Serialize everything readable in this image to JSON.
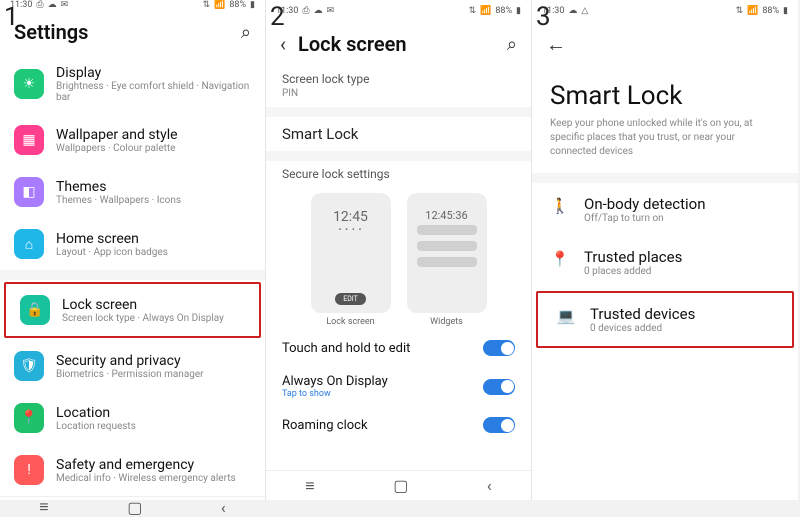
{
  "status": {
    "time": "11:30",
    "battery": "88%"
  },
  "panel1": {
    "title": "Settings",
    "items": [
      {
        "title": "Display",
        "sub": "Brightness · Eye comfort shield · Navigation bar",
        "color": "#1ec97a",
        "glyph": "☀"
      },
      {
        "title": "Wallpaper and style",
        "sub": "Wallpapers · Colour palette",
        "color": "#ff3e8e",
        "glyph": "▦"
      },
      {
        "title": "Themes",
        "sub": "Themes · Wallpapers · Icons",
        "color": "#a97cff",
        "glyph": "◧"
      },
      {
        "title": "Home screen",
        "sub": "Layout · App icon badges",
        "color": "#1fb6e8",
        "glyph": "⌂"
      },
      {
        "title": "Lock screen",
        "sub": "Screen lock type · Always On Display",
        "color": "#18c29c",
        "glyph": "🔒",
        "highlight": true
      },
      {
        "title": "Security and privacy",
        "sub": "Biometrics · Permission manager",
        "color": "#24b0d8",
        "glyph": "🛡"
      },
      {
        "title": "Location",
        "sub": "Location requests",
        "color": "#1fc06a",
        "glyph": "📍"
      },
      {
        "title": "Safety and emergency",
        "sub": "Medical info · Wireless emergency alerts",
        "color": "#ff5a5a",
        "glyph": "!"
      }
    ]
  },
  "panel2": {
    "title": "Lock screen",
    "lockType": {
      "label": "Screen lock type",
      "value": "PIN"
    },
    "smartLock": "Smart Lock",
    "secure": "Secure lock settings",
    "preview1": {
      "time": "12:45",
      "label": "Lock screen",
      "edit": "EDIT"
    },
    "preview2": {
      "time": "12:45:36",
      "label": "Widgets"
    },
    "toggles": [
      {
        "title": "Touch and hold to edit",
        "sub": ""
      },
      {
        "title": "Always On Display",
        "sub": "Tap to show"
      },
      {
        "title": "Roaming clock",
        "sub": ""
      }
    ]
  },
  "panel3": {
    "title": "Smart Lock",
    "desc": "Keep your phone unlocked while it's on you, at specific places that you trust, or near your connected devices",
    "items": [
      {
        "title": "On-body detection",
        "sub": "Off/Tap to turn on",
        "glyph": "🚶"
      },
      {
        "title": "Trusted places",
        "sub": "0 places added",
        "glyph": "📍"
      },
      {
        "title": "Trusted devices",
        "sub": "0 devices added",
        "glyph": "💻",
        "highlight": true
      }
    ]
  }
}
